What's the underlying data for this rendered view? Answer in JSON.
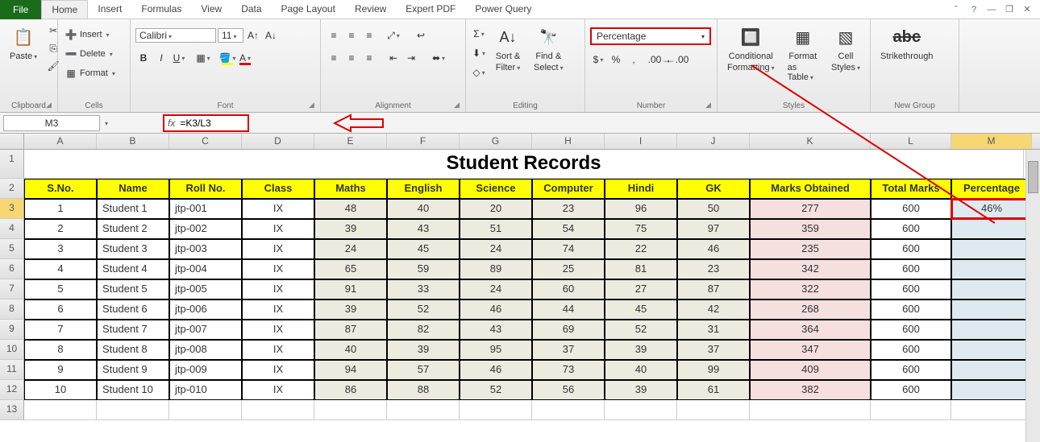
{
  "tabs": {
    "file": "File",
    "items": [
      "Home",
      "Insert",
      "Formulas",
      "View",
      "Data",
      "Page Layout",
      "Review",
      "Expert PDF",
      "Power Query"
    ],
    "active": "Home"
  },
  "ribbon": {
    "clipboard": {
      "label": "Clipboard",
      "paste": "Paste"
    },
    "cells": {
      "label": "Cells",
      "insert": "Insert",
      "delete": "Delete",
      "format": "Format"
    },
    "font": {
      "label": "Font",
      "name": "Calibri",
      "size": "11"
    },
    "alignment": {
      "label": "Alignment"
    },
    "editing": {
      "label": "Editing",
      "sort": "Sort &",
      "filter": "Filter",
      "find": "Find &",
      "select": "Select"
    },
    "number": {
      "label": "Number",
      "format": "Percentage"
    },
    "styles": {
      "label": "Styles",
      "cond1": "Conditional",
      "cond2": "Formatting",
      "fmt1": "Format",
      "fmt2": "as Table",
      "cell1": "Cell",
      "cell2": "Styles"
    },
    "newgroup": {
      "label": "New Group",
      "strike": "Strikethrough"
    }
  },
  "formula_bar": {
    "name_box": "M3",
    "formula": "=K3/L3"
  },
  "columns": [
    "A",
    "B",
    "C",
    "D",
    "E",
    "F",
    "G",
    "H",
    "I",
    "J",
    "K",
    "L",
    "M"
  ],
  "title": "Student Records",
  "headers": [
    "S.No.",
    "Name",
    "Roll No.",
    "Class",
    "Maths",
    "English",
    "Science",
    "Computer",
    "Hindi",
    "GK",
    "Marks Obtained",
    "Total Marks",
    "Percentage"
  ],
  "rows": [
    {
      "sno": "1",
      "name": "Student 1",
      "roll": "jtp-001",
      "class": "IX",
      "maths": "48",
      "eng": "40",
      "sci": "20",
      "comp": "23",
      "hindi": "96",
      "gk": "50",
      "obt": "277",
      "tot": "600",
      "pct": "46%"
    },
    {
      "sno": "2",
      "name": "Student 2",
      "roll": "jtp-002",
      "class": "IX",
      "maths": "39",
      "eng": "43",
      "sci": "51",
      "comp": "54",
      "hindi": "75",
      "gk": "97",
      "obt": "359",
      "tot": "600",
      "pct": ""
    },
    {
      "sno": "3",
      "name": "Student 3",
      "roll": "jtp-003",
      "class": "IX",
      "maths": "24",
      "eng": "45",
      "sci": "24",
      "comp": "74",
      "hindi": "22",
      "gk": "46",
      "obt": "235",
      "tot": "600",
      "pct": ""
    },
    {
      "sno": "4",
      "name": "Student 4",
      "roll": "jtp-004",
      "class": "IX",
      "maths": "65",
      "eng": "59",
      "sci": "89",
      "comp": "25",
      "hindi": "81",
      "gk": "23",
      "obt": "342",
      "tot": "600",
      "pct": ""
    },
    {
      "sno": "5",
      "name": "Student 5",
      "roll": "jtp-005",
      "class": "IX",
      "maths": "91",
      "eng": "33",
      "sci": "24",
      "comp": "60",
      "hindi": "27",
      "gk": "87",
      "obt": "322",
      "tot": "600",
      "pct": ""
    },
    {
      "sno": "6",
      "name": "Student 6",
      "roll": "jtp-006",
      "class": "IX",
      "maths": "39",
      "eng": "52",
      "sci": "46",
      "comp": "44",
      "hindi": "45",
      "gk": "42",
      "obt": "268",
      "tot": "600",
      "pct": ""
    },
    {
      "sno": "7",
      "name": "Student 7",
      "roll": "jtp-007",
      "class": "IX",
      "maths": "87",
      "eng": "82",
      "sci": "43",
      "comp": "69",
      "hindi": "52",
      "gk": "31",
      "obt": "364",
      "tot": "600",
      "pct": ""
    },
    {
      "sno": "8",
      "name": "Student 8",
      "roll": "jtp-008",
      "class": "IX",
      "maths": "40",
      "eng": "39",
      "sci": "95",
      "comp": "37",
      "hindi": "39",
      "gk": "37",
      "obt": "347",
      "tot": "600",
      "pct": ""
    },
    {
      "sno": "9",
      "name": "Student 9",
      "roll": "jtp-009",
      "class": "IX",
      "maths": "94",
      "eng": "57",
      "sci": "46",
      "comp": "73",
      "hindi": "40",
      "gk": "99",
      "obt": "409",
      "tot": "600",
      "pct": ""
    },
    {
      "sno": "10",
      "name": "Student 10",
      "roll": "jtp-010",
      "class": "IX",
      "maths": "86",
      "eng": "88",
      "sci": "52",
      "comp": "56",
      "hindi": "39",
      "gk": "61",
      "obt": "382",
      "tot": "600",
      "pct": ""
    }
  ],
  "selected": {
    "col": "M",
    "row": 3
  }
}
